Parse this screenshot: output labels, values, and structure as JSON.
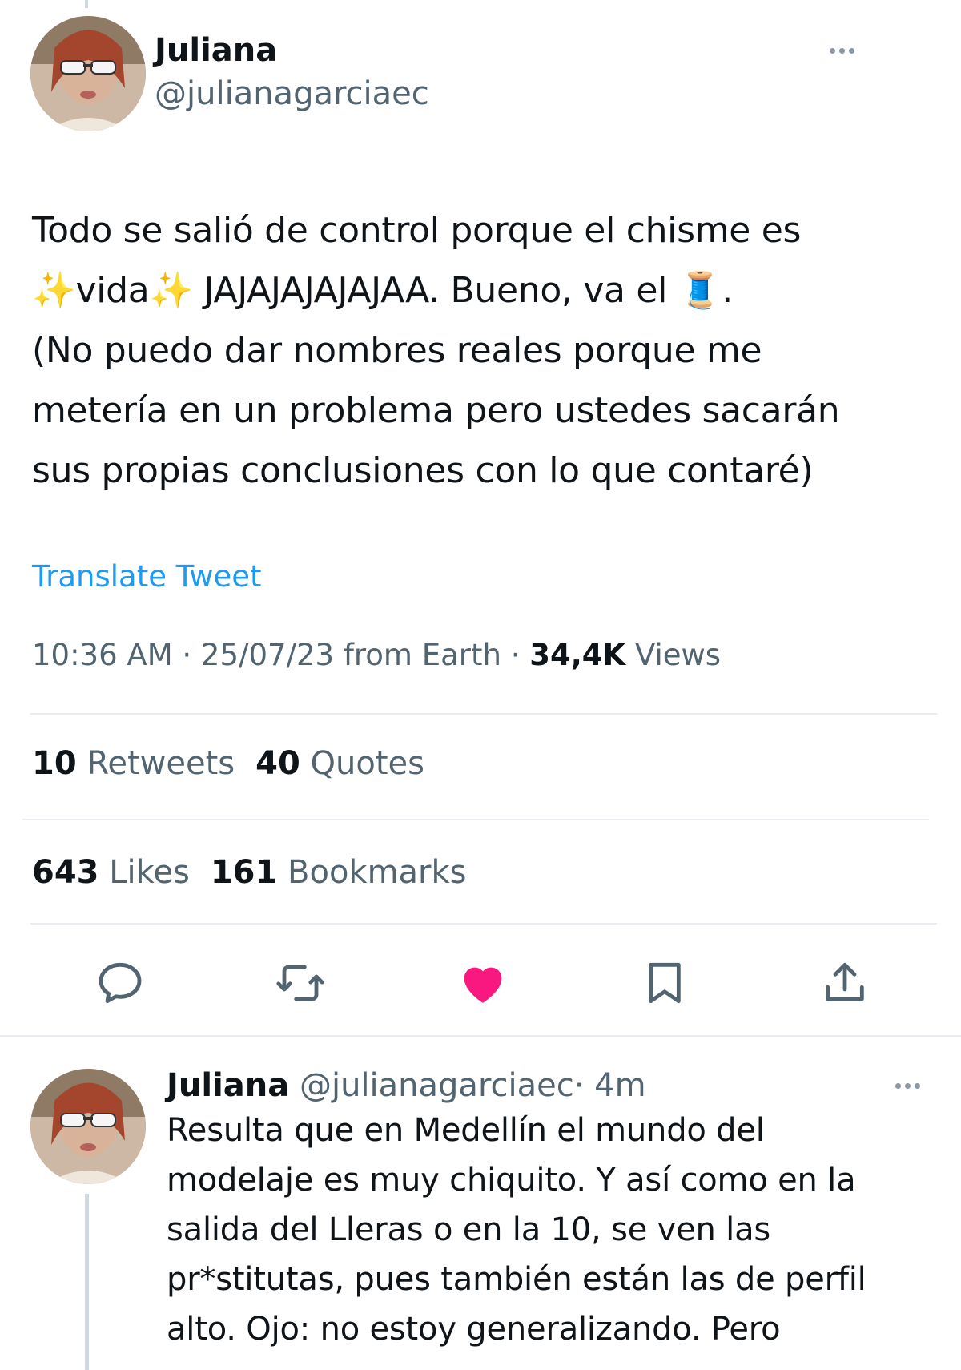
{
  "main_tweet": {
    "author_name": "Juliana",
    "author_handle": "@julianagarciaec",
    "text": {
      "line1": "Todo se salió de control porque el chisme es",
      "line2_sparkle_left": "✨",
      "line2_a": "vida",
      "line2_sparkle_right": "✨",
      "line2_b": " JAJAJAJAJAJAA. Bueno, va el ",
      "line2_emoji": "🧵",
      "line2_c": ".",
      "line3": "(No puedo dar nombres reales porque me",
      "line4": "metería en un problema pero ustedes sacarán",
      "line5": "sus propias conclusiones con lo que contaré)"
    },
    "translate_label": "Translate Tweet",
    "timestamp": "10:36 AM · 25/07/23 from Earth · ",
    "views_count": "34,4K",
    "views_label": " Views",
    "stats": {
      "retweets_count": "10",
      "retweets_label": " Retweets",
      "quotes_count": "40",
      "quotes_label": " Quotes",
      "likes_count": "643",
      "likes_label": " Likes",
      "bookmarks_count": "161",
      "bookmarks_label": " Bookmarks"
    },
    "like_color": "#f91880"
  },
  "reply_tweet": {
    "author_name": "Juliana",
    "author_handle": "@julianagarciaec",
    "time": "· 4m",
    "lines": [
      "Resulta que en Medellín el mundo del",
      "modelaje es muy chiquito. Y así como en la",
      "salida del Lleras o en la 10, se ven las",
      "pr*stitutas, pues también están las de perfil",
      "alto. Ojo: no estoy generalizando. Pero"
    ]
  },
  "icons": [
    "more-icon",
    "reply-icon",
    "retweet-icon",
    "like-icon",
    "bookmark-icon",
    "share-icon",
    "thread-emoji",
    "sparkles-emoji"
  ]
}
